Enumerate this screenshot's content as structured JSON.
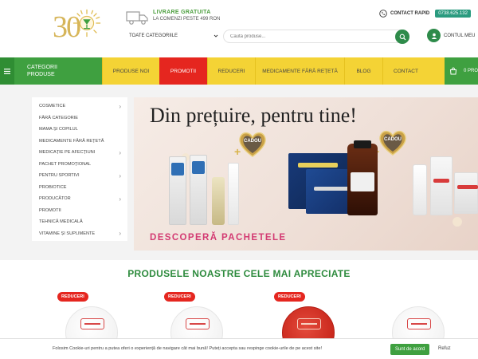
{
  "header": {
    "logo_text": "30",
    "shipping": {
      "title": "LIVRARE GRATUITA",
      "subtitle": "LA COMENZI PESTE 499 RON"
    },
    "contact": {
      "label": "CONTACT RAPID",
      "phone": "0738.625.132"
    },
    "category_select": {
      "selected": "TOATE CATEGORIILE"
    },
    "search": {
      "placeholder": "Cauta produse..."
    },
    "account_label": "CONTUL MEU"
  },
  "nav": {
    "categories_label": "CATEGORII PRODUSE",
    "items": [
      {
        "label": "PRODUSE NOI"
      },
      {
        "label": "PROMOTII"
      },
      {
        "label": "REDUCERI"
      },
      {
        "label": "MEDICAMENTE FĂRĂ REȚETĂ"
      },
      {
        "label": "BLOG"
      },
      {
        "label": "CONTACT"
      }
    ],
    "active_index": 1,
    "cart_label": "0 PRO"
  },
  "sidebar": {
    "items": [
      {
        "label": "COSMETICE",
        "has_children": true
      },
      {
        "label": "FĂRĂ CATEGORIE",
        "has_children": false
      },
      {
        "label": "MAMA ȘI COPILUL",
        "has_children": false
      },
      {
        "label": "MEDICAMENTE FĂRĂ REȚETĂ",
        "has_children": false
      },
      {
        "label": "MEDICAȚIE PE AFECȚIUNI",
        "has_children": true
      },
      {
        "label": "PACHET PROMOȚIONAL",
        "has_children": false
      },
      {
        "label": "PENTRU SPORTIVI",
        "has_children": true
      },
      {
        "label": "PROBIOTICE",
        "has_children": false
      },
      {
        "label": "PRODUCĂTOR",
        "has_children": true
      },
      {
        "label": "PROMOTII",
        "has_children": false
      },
      {
        "label": "TEHNICĂ MEDICALĂ",
        "has_children": false
      },
      {
        "label": "VITAMINE ȘI SUPLIMENTE",
        "has_children": true
      }
    ]
  },
  "banner": {
    "title": "Din prețuire, pentru tine!",
    "gift_label": "CADOU",
    "cta": "DESCOPERĂ PACHETELE"
  },
  "products": {
    "section_title": "PRODUSELE NOASTRE CELE MAI APRECIATE",
    "items": [
      {
        "badge": "REDUCERI"
      },
      {
        "badge": "REDUCERI"
      },
      {
        "badge": "REDUCERI"
      },
      {
        "badge": ""
      }
    ]
  },
  "cookie": {
    "text": "Folosim Cookie-uri pentru a putea oferi o experiență de navigare cât mai bună! Puteți accepta sau respinge cookie-urile de pe acest site!",
    "accept": "Sunt de acord",
    "refuse": "Refuz"
  },
  "colors": {
    "brand_green": "#3fa040",
    "nav_yellow": "#f4d335",
    "promo_red": "#e5261f",
    "phone_teal": "#2a9b7f",
    "cta_pink": "#d33a72",
    "title_green": "#2e8b3e"
  },
  "icons": {
    "logo": "sun-logo-icon",
    "shipping": "truck-icon",
    "phone": "phone-icon",
    "search": "search-icon",
    "account": "user-icon",
    "menu": "hamburger-icon",
    "cart": "cart-icon",
    "gift": "heart-gift-icon"
  }
}
